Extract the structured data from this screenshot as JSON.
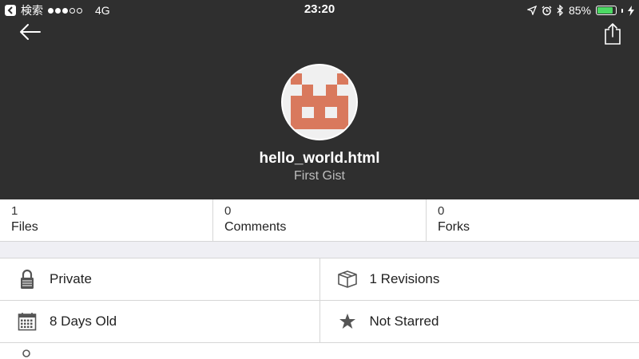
{
  "status_bar": {
    "back_app": "検索",
    "carrier": "4G",
    "time": "23:20",
    "battery_percent": "85%",
    "battery_level": 0.85,
    "signal_bars_filled": 3,
    "signal_bars_total": 5
  },
  "gist": {
    "title": "hello_world.html",
    "subtitle": "First Gist"
  },
  "counts": [
    {
      "value": "1",
      "label": "Files"
    },
    {
      "value": "0",
      "label": "Comments"
    },
    {
      "value": "0",
      "label": "Forks"
    }
  ],
  "info": {
    "visibility": "Private",
    "revisions": "1 Revisions",
    "age": "8 Days Old",
    "starred": "Not Starred"
  },
  "colors": {
    "header_bg": "#2f2f2f",
    "avatar_pattern": "#d9795d",
    "battery_fill": "#4cd964"
  }
}
